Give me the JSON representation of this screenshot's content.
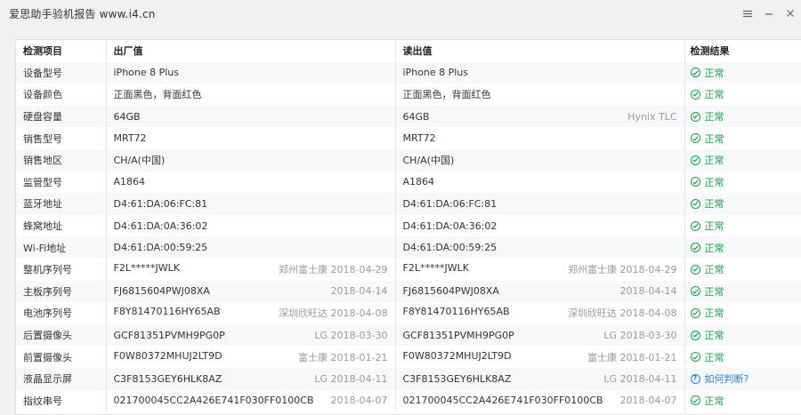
{
  "window": {
    "title": "爱思助手验机报告 www.i4.cn",
    "controls": [
      "menu-icon",
      "minimize-icon",
      "close-icon"
    ]
  },
  "table": {
    "headers": [
      "检测项目",
      "出厂值",
      "读出值",
      "检测结果"
    ],
    "rows": [
      {
        "item": "设备型号",
        "factory": "iPhone 8 Plus",
        "factory_meta": "",
        "read": "iPhone 8 Plus",
        "read_meta": "",
        "result": "正常",
        "status": "ok"
      },
      {
        "item": "设备颜色",
        "factory": "正面黑色，背面红色",
        "factory_meta": "",
        "read": "正面黑色，背面红色",
        "read_meta": "",
        "result": "正常",
        "status": "ok"
      },
      {
        "item": "硬盘容量",
        "factory": "64GB",
        "factory_meta": "",
        "read": "64GB",
        "read_meta": "Hynix TLC",
        "result": "正常",
        "status": "ok"
      },
      {
        "item": "销售型号",
        "factory": "MRT72",
        "factory_meta": "",
        "read": "MRT72",
        "read_meta": "",
        "result": "正常",
        "status": "ok"
      },
      {
        "item": "销售地区",
        "factory": "CH/A(中国)",
        "factory_meta": "",
        "read": "CH/A(中国)",
        "read_meta": "",
        "result": "正常",
        "status": "ok"
      },
      {
        "item": "监管型号",
        "factory": "A1864",
        "factory_meta": "",
        "read": "A1864",
        "read_meta": "",
        "result": "正常",
        "status": "ok"
      },
      {
        "item": "蓝牙地址",
        "factory": "D4:61:DA:06:FC:81",
        "factory_meta": "",
        "read": "D4:61:DA:06:FC:81",
        "read_meta": "",
        "result": "正常",
        "status": "ok"
      },
      {
        "item": "蜂窝地址",
        "factory": "D4:61:DA:0A:36:02",
        "factory_meta": "",
        "read": "D4:61:DA:0A:36:02",
        "read_meta": "",
        "result": "正常",
        "status": "ok"
      },
      {
        "item": "Wi-Fi地址",
        "factory": "D4:61:DA:00:59:25",
        "factory_meta": "",
        "read": "D4:61:DA:00:59:25",
        "read_meta": "",
        "result": "正常",
        "status": "ok"
      },
      {
        "item": "整机序列号",
        "factory": "F2L*****JWLK",
        "factory_meta": "郑州富士康 2018-04-29",
        "read": "F2L*****JWLK",
        "read_meta": "郑州富士康 2018-04-29",
        "result": "正常",
        "status": "ok"
      },
      {
        "item": "主板序列号",
        "factory": "FJ6815604PWJ08XA",
        "factory_meta": "2018-04-14",
        "read": "FJ6815604PWJ08XA",
        "read_meta": "2018-04-14",
        "result": "正常",
        "status": "ok"
      },
      {
        "item": "电池序列号",
        "factory": "F8Y81470116HY65AB",
        "factory_meta": "深圳欣旺达 2018-04-08",
        "read": "F8Y81470116HY65AB",
        "read_meta": "深圳欣旺达 2018-04-08",
        "result": "正常",
        "status": "ok"
      },
      {
        "item": "后置摄像头",
        "factory": "GCF81351PVMH9PG0P",
        "factory_meta": "LG 2018-03-30",
        "read": "GCF81351PVMH9PG0P",
        "read_meta": "LG 2018-03-30",
        "result": "正常",
        "status": "ok"
      },
      {
        "item": "前置摄像头",
        "factory": "F0W80372MHUJ2LT9D",
        "factory_meta": "富士康 2018-01-21",
        "read": "F0W80372MHUJ2LT9D",
        "read_meta": "富士康 2018-01-21",
        "result": "正常",
        "status": "ok"
      },
      {
        "item": "液晶显示屏",
        "factory": "C3F8153GEY6HLK8AZ",
        "factory_meta": "LG 2018-04-11",
        "read": "C3F8153GEY6HLK8AZ",
        "read_meta": "LG 2018-04-11",
        "result": "如何判断?",
        "status": "help"
      },
      {
        "item": "指纹串号",
        "factory": "021700045CC2A426E741F030FF0100CB",
        "factory_meta": "2018-04-07",
        "read": "021700045CC2A426E741F030FF0100CB",
        "read_meta": "2018-04-07",
        "result": "正常",
        "status": "ok"
      }
    ]
  },
  "colors": {
    "ok": "#19a24a",
    "help": "#2a7de1"
  }
}
